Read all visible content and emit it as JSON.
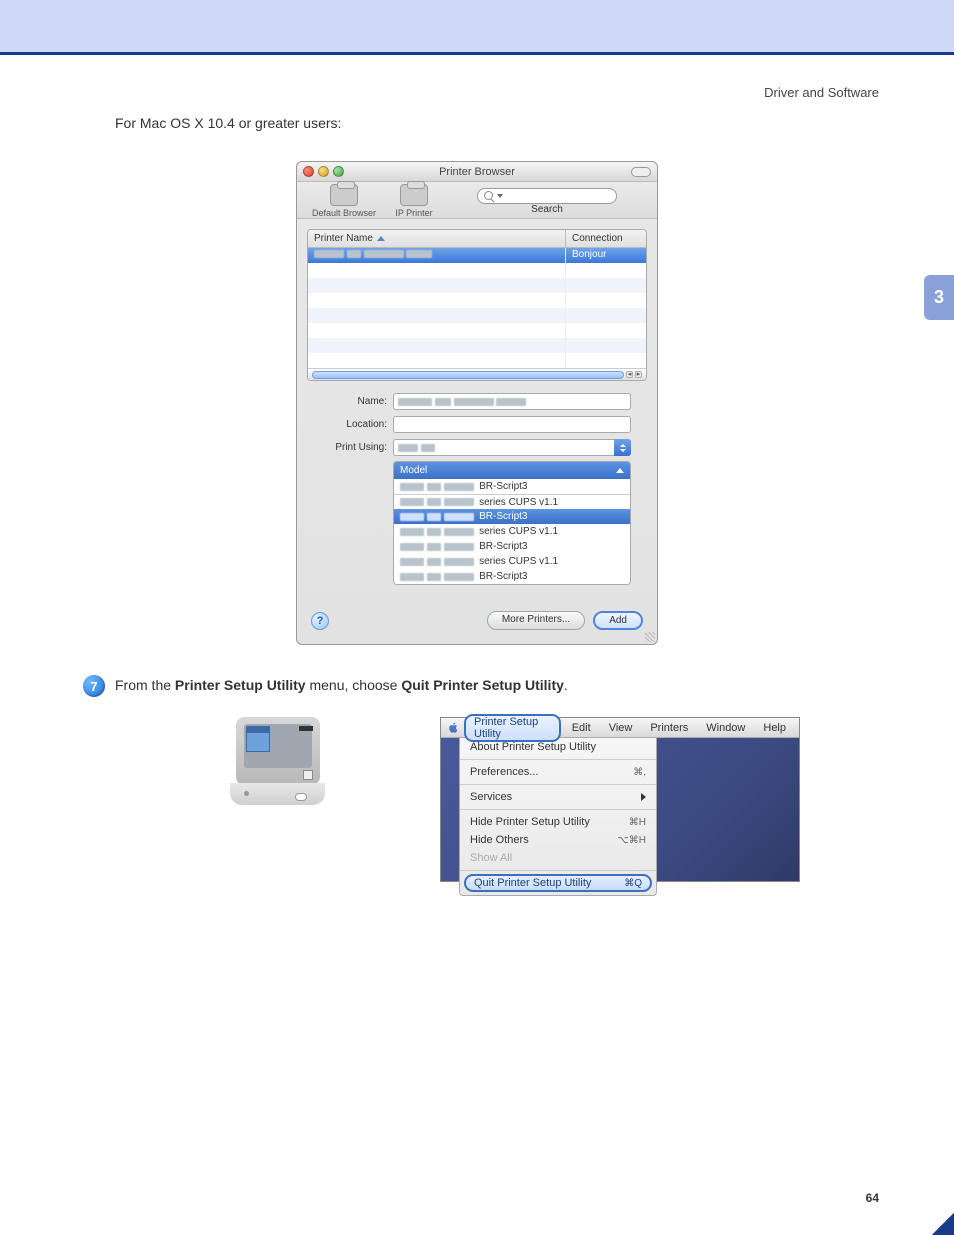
{
  "header": "Driver and Software",
  "chapter_tab": "3",
  "intro": "For Mac OS X 10.4 or greater users:",
  "printer_browser": {
    "title": "Printer Browser",
    "toolbar": {
      "default_browser": "Default Browser",
      "ip_printer": "IP Printer",
      "search": "Search"
    },
    "table": {
      "col_name": "Printer Name",
      "col_conn": "Connection",
      "row0_conn": "Bonjour"
    },
    "form": {
      "name_label": "Name:",
      "location_label": "Location:",
      "print_using_label": "Print Using:",
      "model_header": "Model",
      "models": [
        "BR-Script3",
        "series CUPS v1.1",
        "BR-Script3",
        "series CUPS v1.1",
        "BR-Script3",
        "series CUPS v1.1",
        "BR-Script3"
      ]
    },
    "help": "?",
    "more_printers": "More Printers...",
    "add": "Add"
  },
  "step": {
    "num": "7",
    "pre": "From the ",
    "b1": "Printer Setup Utility",
    "mid": " menu, choose ",
    "b2": "Quit Printer Setup Utility",
    "post": "."
  },
  "menubar": {
    "app": "Printer Setup Utility",
    "items": [
      "Edit",
      "View",
      "Printers",
      "Window",
      "Help"
    ],
    "dropdown": {
      "about": "About Printer Setup Utility",
      "prefs": "Preferences...",
      "prefs_key": "⌘,",
      "services": "Services",
      "hide": "Hide Printer Setup Utility",
      "hide_key": "⌘H",
      "hide_others": "Hide Others",
      "hide_others_key": "⌥⌘H",
      "show_all": "Show All",
      "quit": "Quit Printer Setup Utility",
      "quit_key": "⌘Q"
    }
  },
  "page_number": "64"
}
